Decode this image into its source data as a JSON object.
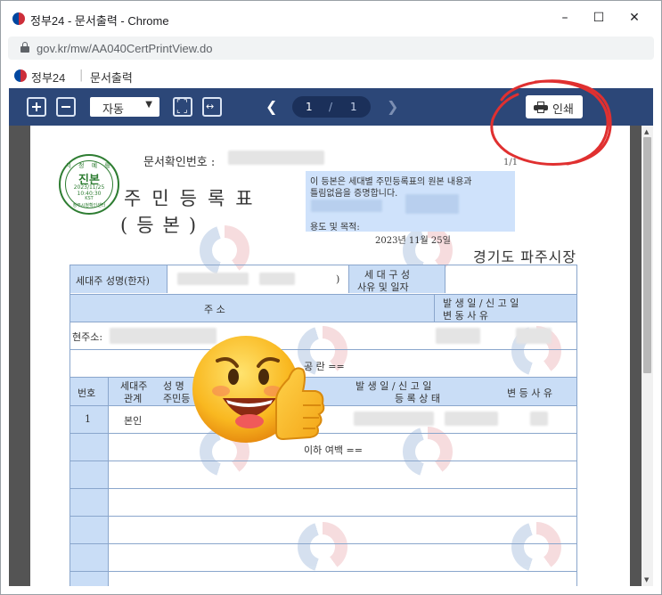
{
  "window": {
    "title": "정부24 - 문서출력 - Chrome",
    "controls": {
      "minimize": "–",
      "maximize": "☐",
      "close": "✕"
    }
  },
  "address_bar": {
    "url": "gov.kr/mw/AA040CertPrintView.do"
  },
  "site_header": {
    "site_name": "정부24",
    "separator": "|",
    "page_name": "문서출력"
  },
  "toolbar": {
    "zoom_value": "자동",
    "page_current": "1",
    "page_separator": "/",
    "page_total": "1",
    "print_label": "인쇄",
    "prev_arrow": "❮",
    "next_arrow": "❯"
  },
  "document": {
    "doc_number_label": "문서확인번호 :",
    "page_count": "1/1",
    "title": "주민등록표",
    "subtitle": "(등본)",
    "seal": {
      "top_text": "시 청 예 를",
      "main": "진본",
      "date": "2023/11/25",
      "time": "10:40:30",
      "tz": "KST",
      "bottom_text": "정부시청확인센터"
    },
    "cert_line_1": "이 등본은 세대별 주민등록표의 원본 내용과",
    "cert_line_2": "틀림없음을 증명합니다.",
    "purpose_label": "용도 및 목적:",
    "issue_date": "2023년 11월 25일",
    "issuer": "경기도 파주시장",
    "table": {
      "householder_label": "세대주 성명(한자)",
      "householder_paren": ")",
      "composition_label_1": "세 대 구 성",
      "composition_label_2": "사유 및 일자",
      "address_header": "주                 소",
      "date_header_1": "발 생 일  /  신 고 일",
      "date_header_2": "변   동     사   유",
      "current_address_label": "현주소:",
      "blank_note": "공     란     ==",
      "col_no": "번호",
      "col_relation_1": "세대주",
      "col_relation_2": "관계",
      "col_name_1": "성  명",
      "col_name_2": "주민등",
      "col_date_1": "발 생 일  /  신 고 일",
      "col_date_2": "등 록 상 태",
      "col_reason": "변 등 사 유",
      "row_1_no": "1",
      "row_1_relation": "본인",
      "end_note": "이하 여백 =="
    }
  }
}
